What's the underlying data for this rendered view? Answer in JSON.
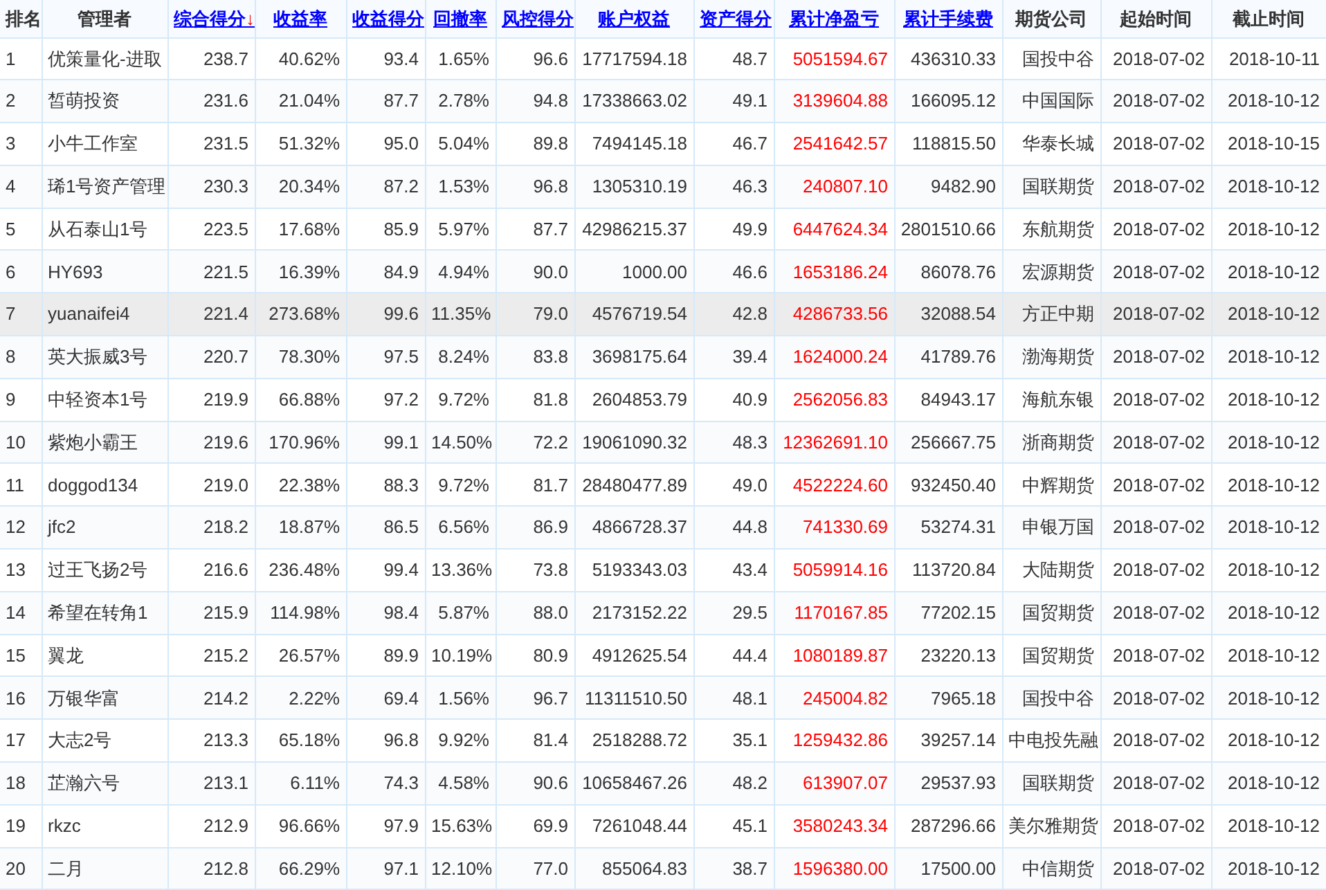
{
  "table": {
    "columns": [
      {
        "label": "排名",
        "kind": "text"
      },
      {
        "label": "管理者",
        "kind": "text"
      },
      {
        "label": "综合得分",
        "kind": "link",
        "sort_mark": "↓"
      },
      {
        "label": "收益率",
        "kind": "link"
      },
      {
        "label": "收益得分",
        "kind": "link"
      },
      {
        "label": "回撤率",
        "kind": "link"
      },
      {
        "label": "风控得分",
        "kind": "link"
      },
      {
        "label": "账户权益",
        "kind": "link"
      },
      {
        "label": "资产得分",
        "kind": "link"
      },
      {
        "label": "累计净盈亏",
        "kind": "link",
        "color": "#ff0000"
      },
      {
        "label": "累计手续费",
        "kind": "link"
      },
      {
        "label": "期货公司",
        "kind": "text"
      },
      {
        "label": "起始时间",
        "kind": "text"
      },
      {
        "label": "截止时间",
        "kind": "text"
      }
    ],
    "rows": [
      {
        "selected": false,
        "cells": [
          "1",
          "优策量化-进取",
          "238.7",
          "40.62%",
          "93.4",
          "1.65%",
          "96.6",
          "17717594.18",
          "48.7",
          "5051594.67",
          "436310.33",
          "国投中谷",
          "2018-07-02",
          "2018-10-11"
        ]
      },
      {
        "selected": false,
        "cells": [
          "2",
          "皙萌投资",
          "231.6",
          "21.04%",
          "87.7",
          "2.78%",
          "94.8",
          "17338663.02",
          "49.1",
          "3139604.88",
          "166095.12",
          "中国国际",
          "2018-07-02",
          "2018-10-12"
        ]
      },
      {
        "selected": false,
        "cells": [
          "3",
          "小牛工作室",
          "231.5",
          "51.32%",
          "95.0",
          "5.04%",
          "89.8",
          "7494145.18",
          "46.7",
          "2541642.57",
          "118815.50",
          "华泰长城",
          "2018-07-02",
          "2018-10-15"
        ]
      },
      {
        "selected": false,
        "cells": [
          "4",
          "琋1号资产管理",
          "230.3",
          "20.34%",
          "87.2",
          "1.53%",
          "96.8",
          "1305310.19",
          "46.3",
          "240807.10",
          "9482.90",
          "国联期货",
          "2018-07-02",
          "2018-10-12"
        ]
      },
      {
        "selected": false,
        "cells": [
          "5",
          "从石泰山1号",
          "223.5",
          "17.68%",
          "85.9",
          "5.97%",
          "87.7",
          "42986215.37",
          "49.9",
          "6447624.34",
          "2801510.66",
          "东航期货",
          "2018-07-02",
          "2018-10-12"
        ]
      },
      {
        "selected": false,
        "cells": [
          "6",
          "HY693",
          "221.5",
          "16.39%",
          "84.9",
          "4.94%",
          "90.0",
          "1000.00",
          "46.6",
          "1653186.24",
          "86078.76",
          "宏源期货",
          "2018-07-02",
          "2018-10-12"
        ]
      },
      {
        "selected": true,
        "cells": [
          "7",
          "yuanaifei4",
          "221.4",
          "273.68%",
          "99.6",
          "11.35%",
          "79.0",
          "4576719.54",
          "42.8",
          "4286733.56",
          "32088.54",
          "方正中期",
          "2018-07-02",
          "2018-10-12"
        ]
      },
      {
        "selected": false,
        "cells": [
          "8",
          "英大振威3号",
          "220.7",
          "78.30%",
          "97.5",
          "8.24%",
          "83.8",
          "3698175.64",
          "39.4",
          "1624000.24",
          "41789.76",
          "渤海期货",
          "2018-07-02",
          "2018-10-12"
        ]
      },
      {
        "selected": false,
        "cells": [
          "9",
          "中轻资本1号",
          "219.9",
          "66.88%",
          "97.2",
          "9.72%",
          "81.8",
          "2604853.79",
          "40.9",
          "2562056.83",
          "84943.17",
          "海航东银",
          "2018-07-02",
          "2018-10-12"
        ]
      },
      {
        "selected": false,
        "cells": [
          "10",
          "紫炮小霸王",
          "219.6",
          "170.96%",
          "99.1",
          "14.50%",
          "72.2",
          "19061090.32",
          "48.3",
          "12362691.10",
          "256667.75",
          "浙商期货",
          "2018-07-02",
          "2018-10-12"
        ]
      },
      {
        "selected": false,
        "cells": [
          "11",
          "doggod134",
          "219.0",
          "22.38%",
          "88.3",
          "9.72%",
          "81.7",
          "28480477.89",
          "49.0",
          "4522224.60",
          "932450.40",
          "中辉期货",
          "2018-07-02",
          "2018-10-12"
        ]
      },
      {
        "selected": false,
        "cells": [
          "12",
          "jfc2",
          "218.2",
          "18.87%",
          "86.5",
          "6.56%",
          "86.9",
          "4866728.37",
          "44.8",
          "741330.69",
          "53274.31",
          "申银万国",
          "2018-07-02",
          "2018-10-12"
        ]
      },
      {
        "selected": false,
        "cells": [
          "13",
          "过王飞扬2号",
          "216.6",
          "236.48%",
          "99.4",
          "13.36%",
          "73.8",
          "5193343.03",
          "43.4",
          "5059914.16",
          "113720.84",
          "大陆期货",
          "2018-07-02",
          "2018-10-12"
        ]
      },
      {
        "selected": false,
        "cells": [
          "14",
          "希望在转角1",
          "215.9",
          "114.98%",
          "98.4",
          "5.87%",
          "88.0",
          "2173152.22",
          "29.5",
          "1170167.85",
          "77202.15",
          "国贸期货",
          "2018-07-02",
          "2018-10-12"
        ]
      },
      {
        "selected": false,
        "cells": [
          "15",
          "翼龙",
          "215.2",
          "26.57%",
          "89.9",
          "10.19%",
          "80.9",
          "4912625.54",
          "44.4",
          "1080189.87",
          "23220.13",
          "国贸期货",
          "2018-07-02",
          "2018-10-12"
        ]
      },
      {
        "selected": false,
        "cells": [
          "16",
          "万银华富",
          "214.2",
          "2.22%",
          "69.4",
          "1.56%",
          "96.7",
          "11311510.50",
          "48.1",
          "245004.82",
          "7965.18",
          "国投中谷",
          "2018-07-02",
          "2018-10-12"
        ]
      },
      {
        "selected": false,
        "cells": [
          "17",
          "大志2号",
          "213.3",
          "65.18%",
          "96.8",
          "9.92%",
          "81.4",
          "2518288.72",
          "35.1",
          "1259432.86",
          "39257.14",
          "中电投先融",
          "2018-07-02",
          "2018-10-12"
        ]
      },
      {
        "selected": false,
        "cells": [
          "18",
          "芷瀚六号",
          "213.1",
          "6.11%",
          "74.3",
          "4.58%",
          "90.6",
          "10658467.26",
          "48.2",
          "613907.07",
          "29537.93",
          "国联期货",
          "2018-07-02",
          "2018-10-12"
        ]
      },
      {
        "selected": false,
        "cells": [
          "19",
          "rkzc",
          "212.9",
          "96.66%",
          "97.9",
          "15.63%",
          "69.9",
          "7261048.44",
          "45.1",
          "3580243.34",
          "287296.66",
          "美尔雅期货",
          "2018-07-02",
          "2018-10-12"
        ]
      },
      {
        "selected": false,
        "cells": [
          "20",
          "二月",
          "212.8",
          "66.29%",
          "97.1",
          "12.10%",
          "77.0",
          "855064.83",
          "38.7",
          "1596380.00",
          "17500.00",
          "中信期货",
          "2018-07-02",
          "2018-10-12"
        ]
      }
    ]
  }
}
